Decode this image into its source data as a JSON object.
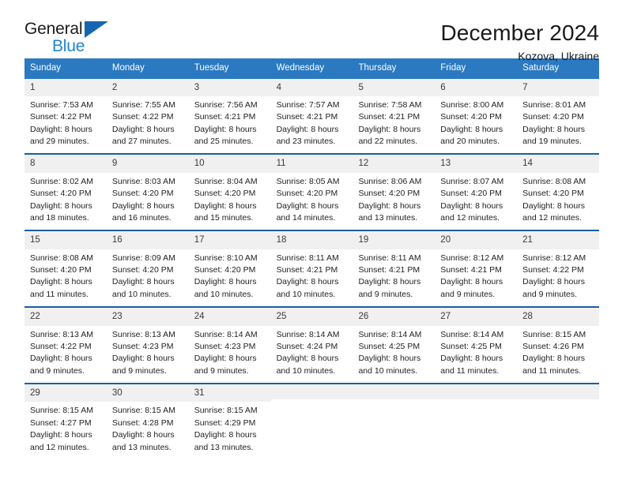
{
  "brand": {
    "name_part1": "General",
    "name_part2": "Blue",
    "triangle_color": "#1565b0",
    "blue_color": "#1e84d6"
  },
  "header": {
    "title": "December 2024",
    "subtitle": "Kozova, Ukraine"
  },
  "theme": {
    "header_blue": "#2a79c1",
    "row_divider_blue": "#1b5fa0",
    "day_band_gray": "#f0f0f0"
  },
  "weekdays": [
    "Sunday",
    "Monday",
    "Tuesday",
    "Wednesday",
    "Thursday",
    "Friday",
    "Saturday"
  ],
  "weeks": [
    [
      {
        "day": "1",
        "sunrise": "Sunrise: 7:53 AM",
        "sunset": "Sunset: 4:22 PM",
        "daylight1": "Daylight: 8 hours",
        "daylight2": "and 29 minutes."
      },
      {
        "day": "2",
        "sunrise": "Sunrise: 7:55 AM",
        "sunset": "Sunset: 4:22 PM",
        "daylight1": "Daylight: 8 hours",
        "daylight2": "and 27 minutes."
      },
      {
        "day": "3",
        "sunrise": "Sunrise: 7:56 AM",
        "sunset": "Sunset: 4:21 PM",
        "daylight1": "Daylight: 8 hours",
        "daylight2": "and 25 minutes."
      },
      {
        "day": "4",
        "sunrise": "Sunrise: 7:57 AM",
        "sunset": "Sunset: 4:21 PM",
        "daylight1": "Daylight: 8 hours",
        "daylight2": "and 23 minutes."
      },
      {
        "day": "5",
        "sunrise": "Sunrise: 7:58 AM",
        "sunset": "Sunset: 4:21 PM",
        "daylight1": "Daylight: 8 hours",
        "daylight2": "and 22 minutes."
      },
      {
        "day": "6",
        "sunrise": "Sunrise: 8:00 AM",
        "sunset": "Sunset: 4:20 PM",
        "daylight1": "Daylight: 8 hours",
        "daylight2": "and 20 minutes."
      },
      {
        "day": "7",
        "sunrise": "Sunrise: 8:01 AM",
        "sunset": "Sunset: 4:20 PM",
        "daylight1": "Daylight: 8 hours",
        "daylight2": "and 19 minutes."
      }
    ],
    [
      {
        "day": "8",
        "sunrise": "Sunrise: 8:02 AM",
        "sunset": "Sunset: 4:20 PM",
        "daylight1": "Daylight: 8 hours",
        "daylight2": "and 18 minutes."
      },
      {
        "day": "9",
        "sunrise": "Sunrise: 8:03 AM",
        "sunset": "Sunset: 4:20 PM",
        "daylight1": "Daylight: 8 hours",
        "daylight2": "and 16 minutes."
      },
      {
        "day": "10",
        "sunrise": "Sunrise: 8:04 AM",
        "sunset": "Sunset: 4:20 PM",
        "daylight1": "Daylight: 8 hours",
        "daylight2": "and 15 minutes."
      },
      {
        "day": "11",
        "sunrise": "Sunrise: 8:05 AM",
        "sunset": "Sunset: 4:20 PM",
        "daylight1": "Daylight: 8 hours",
        "daylight2": "and 14 minutes."
      },
      {
        "day": "12",
        "sunrise": "Sunrise: 8:06 AM",
        "sunset": "Sunset: 4:20 PM",
        "daylight1": "Daylight: 8 hours",
        "daylight2": "and 13 minutes."
      },
      {
        "day": "13",
        "sunrise": "Sunrise: 8:07 AM",
        "sunset": "Sunset: 4:20 PM",
        "daylight1": "Daylight: 8 hours",
        "daylight2": "and 12 minutes."
      },
      {
        "day": "14",
        "sunrise": "Sunrise: 8:08 AM",
        "sunset": "Sunset: 4:20 PM",
        "daylight1": "Daylight: 8 hours",
        "daylight2": "and 12 minutes."
      }
    ],
    [
      {
        "day": "15",
        "sunrise": "Sunrise: 8:08 AM",
        "sunset": "Sunset: 4:20 PM",
        "daylight1": "Daylight: 8 hours",
        "daylight2": "and 11 minutes."
      },
      {
        "day": "16",
        "sunrise": "Sunrise: 8:09 AM",
        "sunset": "Sunset: 4:20 PM",
        "daylight1": "Daylight: 8 hours",
        "daylight2": "and 10 minutes."
      },
      {
        "day": "17",
        "sunrise": "Sunrise: 8:10 AM",
        "sunset": "Sunset: 4:20 PM",
        "daylight1": "Daylight: 8 hours",
        "daylight2": "and 10 minutes."
      },
      {
        "day": "18",
        "sunrise": "Sunrise: 8:11 AM",
        "sunset": "Sunset: 4:21 PM",
        "daylight1": "Daylight: 8 hours",
        "daylight2": "and 10 minutes."
      },
      {
        "day": "19",
        "sunrise": "Sunrise: 8:11 AM",
        "sunset": "Sunset: 4:21 PM",
        "daylight1": "Daylight: 8 hours",
        "daylight2": "and 9 minutes."
      },
      {
        "day": "20",
        "sunrise": "Sunrise: 8:12 AM",
        "sunset": "Sunset: 4:21 PM",
        "daylight1": "Daylight: 8 hours",
        "daylight2": "and 9 minutes."
      },
      {
        "day": "21",
        "sunrise": "Sunrise: 8:12 AM",
        "sunset": "Sunset: 4:22 PM",
        "daylight1": "Daylight: 8 hours",
        "daylight2": "and 9 minutes."
      }
    ],
    [
      {
        "day": "22",
        "sunrise": "Sunrise: 8:13 AM",
        "sunset": "Sunset: 4:22 PM",
        "daylight1": "Daylight: 8 hours",
        "daylight2": "and 9 minutes."
      },
      {
        "day": "23",
        "sunrise": "Sunrise: 8:13 AM",
        "sunset": "Sunset: 4:23 PM",
        "daylight1": "Daylight: 8 hours",
        "daylight2": "and 9 minutes."
      },
      {
        "day": "24",
        "sunrise": "Sunrise: 8:14 AM",
        "sunset": "Sunset: 4:23 PM",
        "daylight1": "Daylight: 8 hours",
        "daylight2": "and 9 minutes."
      },
      {
        "day": "25",
        "sunrise": "Sunrise: 8:14 AM",
        "sunset": "Sunset: 4:24 PM",
        "daylight1": "Daylight: 8 hours",
        "daylight2": "and 10 minutes."
      },
      {
        "day": "26",
        "sunrise": "Sunrise: 8:14 AM",
        "sunset": "Sunset: 4:25 PM",
        "daylight1": "Daylight: 8 hours",
        "daylight2": "and 10 minutes."
      },
      {
        "day": "27",
        "sunrise": "Sunrise: 8:14 AM",
        "sunset": "Sunset: 4:25 PM",
        "daylight1": "Daylight: 8 hours",
        "daylight2": "and 11 minutes."
      },
      {
        "day": "28",
        "sunrise": "Sunrise: 8:15 AM",
        "sunset": "Sunset: 4:26 PM",
        "daylight1": "Daylight: 8 hours",
        "daylight2": "and 11 minutes."
      }
    ],
    [
      {
        "day": "29",
        "sunrise": "Sunrise: 8:15 AM",
        "sunset": "Sunset: 4:27 PM",
        "daylight1": "Daylight: 8 hours",
        "daylight2": "and 12 minutes."
      },
      {
        "day": "30",
        "sunrise": "Sunrise: 8:15 AM",
        "sunset": "Sunset: 4:28 PM",
        "daylight1": "Daylight: 8 hours",
        "daylight2": "and 13 minutes."
      },
      {
        "day": "31",
        "sunrise": "Sunrise: 8:15 AM",
        "sunset": "Sunset: 4:29 PM",
        "daylight1": "Daylight: 8 hours",
        "daylight2": "and 13 minutes."
      },
      {
        "day": "",
        "sunrise": "",
        "sunset": "",
        "daylight1": "",
        "daylight2": ""
      },
      {
        "day": "",
        "sunrise": "",
        "sunset": "",
        "daylight1": "",
        "daylight2": ""
      },
      {
        "day": "",
        "sunrise": "",
        "sunset": "",
        "daylight1": "",
        "daylight2": ""
      },
      {
        "day": "",
        "sunrise": "",
        "sunset": "",
        "daylight1": "",
        "daylight2": ""
      }
    ]
  ]
}
